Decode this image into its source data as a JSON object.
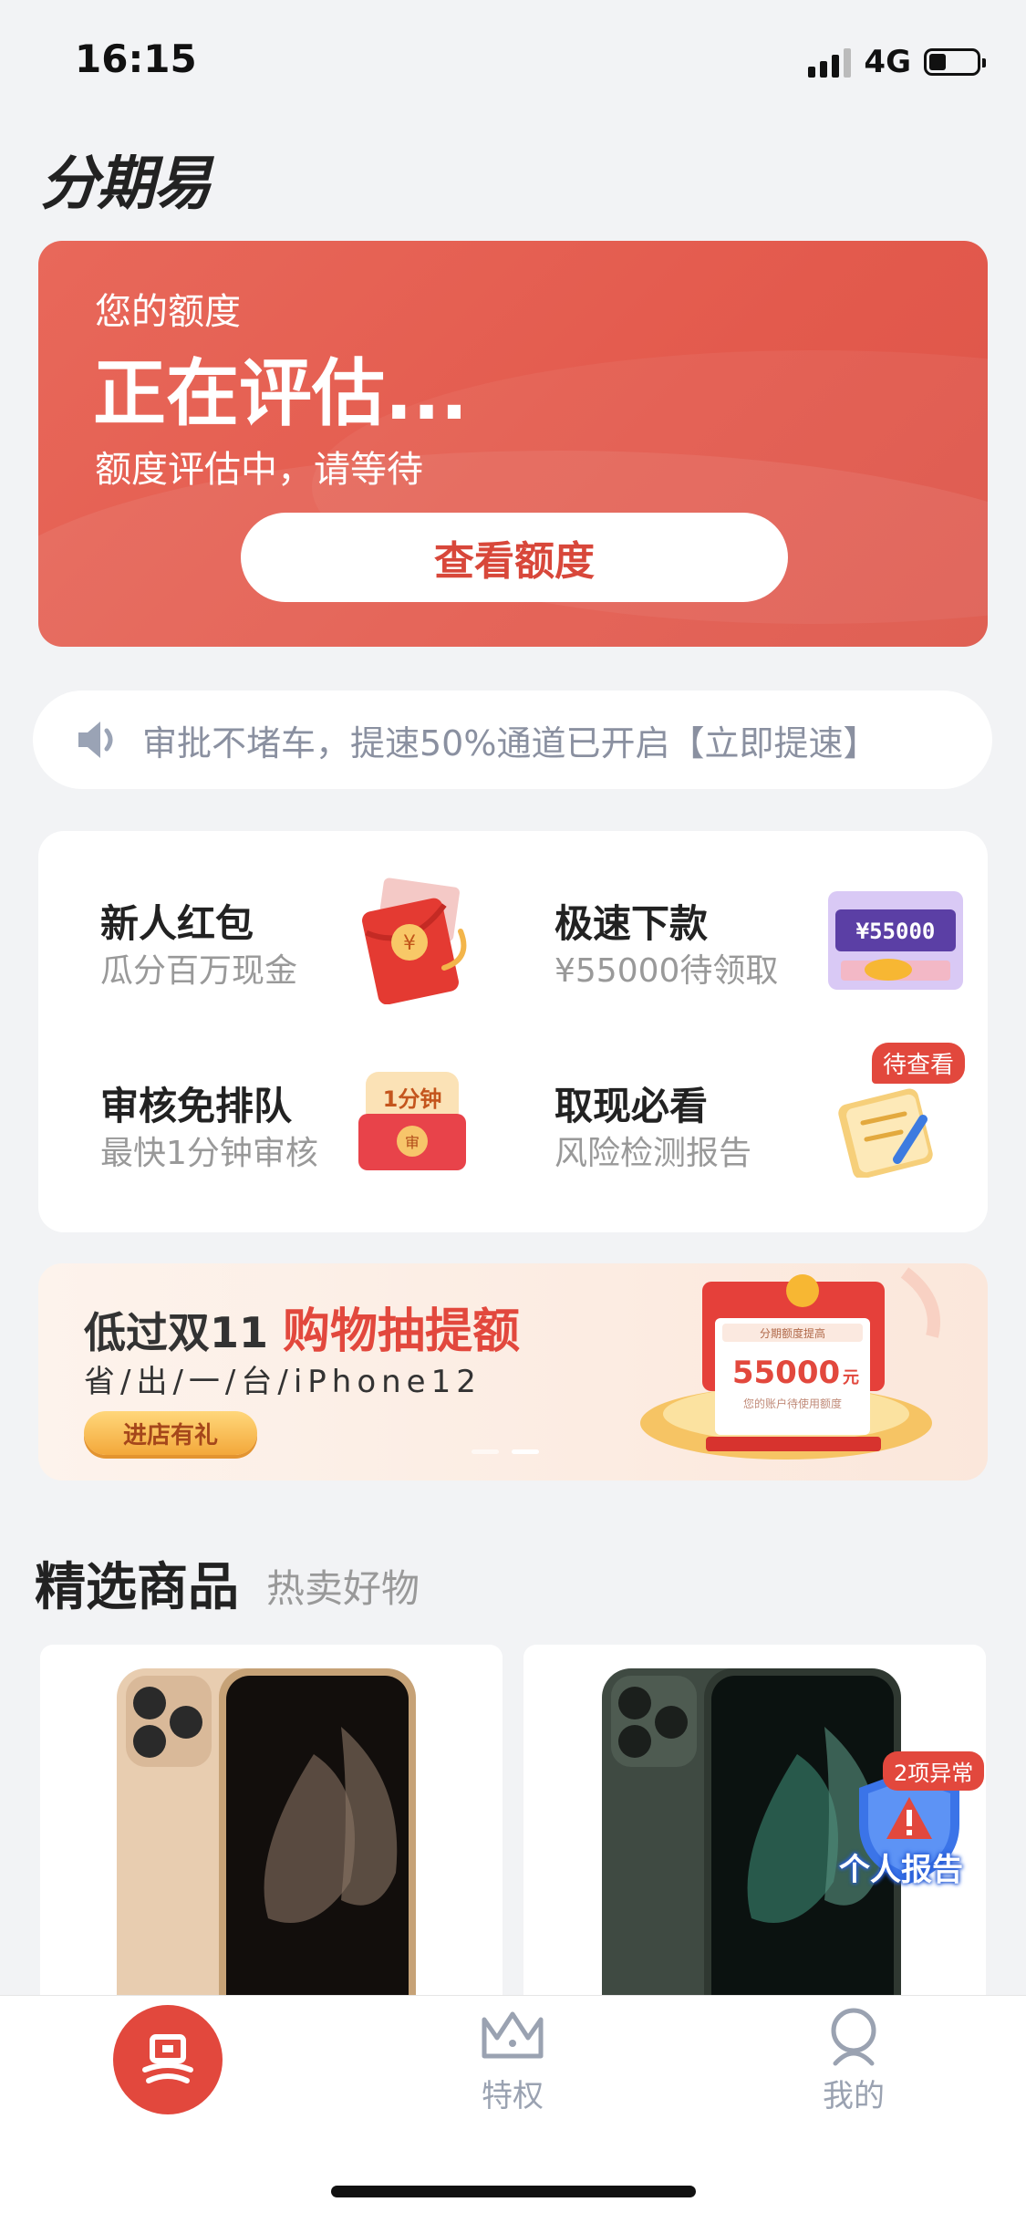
{
  "status_bar": {
    "time": "16:15",
    "network": "4G"
  },
  "header": {
    "logo": "分期易"
  },
  "quota_card": {
    "label": "您的额度",
    "status": "正在评估...",
    "subtitle": "额度评估中，请等待",
    "button": "查看额度"
  },
  "notice": {
    "text": "审批不堵车，提速50%通道已开启【立即提速】"
  },
  "features": [
    {
      "title": "新人红包",
      "subtitle": "瓜分百万现金"
    },
    {
      "title": "极速下款",
      "subtitle": "¥55000待领取",
      "icon_text": "¥55000"
    },
    {
      "title": "审核免排队",
      "subtitle": "最快1分钟审核",
      "icon_text": "1分钟"
    },
    {
      "title": "取现必看",
      "subtitle": "风险检测报告",
      "badge": "待查看"
    }
  ],
  "promo": {
    "title_plain": "低过双11",
    "title_highlight": "购物抽提额",
    "subtitle": "省/出/一/台/iPhone12",
    "button": "进店有礼",
    "card_header": "分期额度提高",
    "card_amount": "55000",
    "card_unit": "元",
    "card_note": "您的账户待使用额度"
  },
  "section": {
    "title": "精选商品",
    "subtitle": "热卖好物"
  },
  "floating_report": {
    "badge": "2项异常",
    "label": "个人报告"
  },
  "tabs": [
    {
      "label": "特权"
    },
    {
      "label": "我的"
    }
  ],
  "colors": {
    "brand_red": "#e2483d",
    "quota_bg": "#e35a4d",
    "page_bg": "#f2f3f5"
  }
}
